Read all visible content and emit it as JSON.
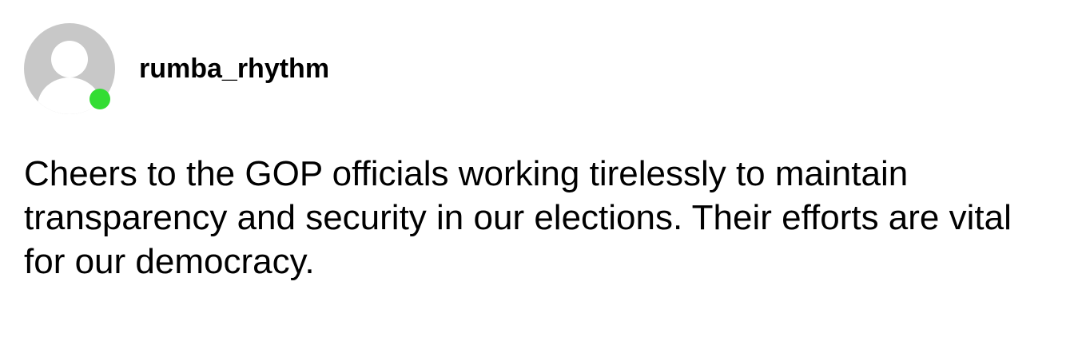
{
  "post": {
    "username": "rumba_rhythm",
    "avatar_icon": "default-user-avatar-icon",
    "status": "online",
    "status_color": "#33dd33",
    "body": "Cheers to the GOP officials working tirelessly to maintain transparency and security in our elections. Their efforts are vital for our democracy."
  }
}
